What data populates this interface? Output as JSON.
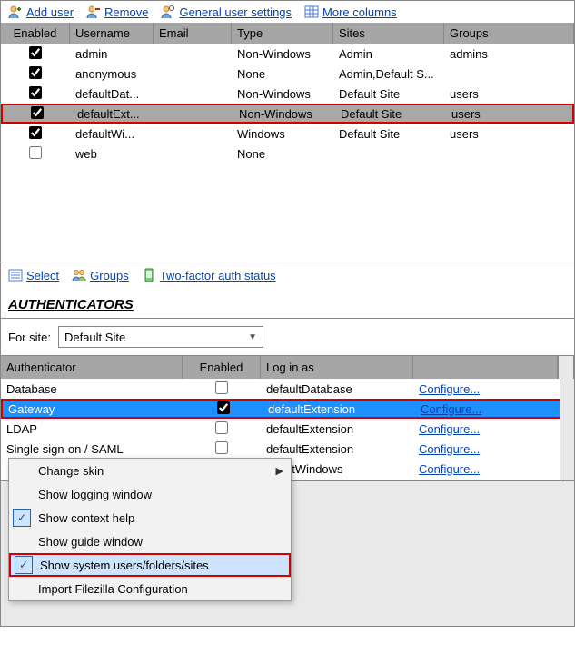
{
  "toolbar": {
    "add_user": "Add user",
    "remove": "Remove",
    "general": "General user settings",
    "more_cols": "More columns"
  },
  "user_grid": {
    "headers": {
      "enabled": "Enabled",
      "username": "Username",
      "email": "Email",
      "type": "Type",
      "sites": "Sites",
      "groups": "Groups"
    },
    "rows": [
      {
        "enabled": true,
        "username": "admin",
        "email": "",
        "type": "Non-Windows",
        "sites": "Admin",
        "groups": "admins",
        "selected": false
      },
      {
        "enabled": true,
        "username": "anonymous",
        "email": "",
        "type": "None",
        "sites": "Admin,Default S...",
        "groups": "",
        "selected": false
      },
      {
        "enabled": true,
        "username": "defaultDat...",
        "email": "",
        "type": "Non-Windows",
        "sites": "Default Site",
        "groups": "users",
        "selected": false
      },
      {
        "enabled": true,
        "username": "defaultExt...",
        "email": "",
        "type": "Non-Windows",
        "sites": "Default Site",
        "groups": "users",
        "selected": true
      },
      {
        "enabled": true,
        "username": "defaultWi...",
        "email": "",
        "type": "Windows",
        "sites": "Default Site",
        "groups": "users",
        "selected": false
      },
      {
        "enabled": false,
        "username": "web",
        "email": "",
        "type": "None",
        "sites": "",
        "groups": "",
        "selected": false
      }
    ]
  },
  "toolbar2": {
    "select": "Select",
    "groups": "Groups",
    "twofa": "Two-factor auth status"
  },
  "auth": {
    "heading": "AUTHENTICATORS",
    "for_site_label": "For site:",
    "for_site_value": "Default Site",
    "headers": {
      "authenticator": "Authenticator",
      "enabled": "Enabled",
      "login_as": "Log in as"
    },
    "configure_label": "Configure...",
    "rows": [
      {
        "name": "Database",
        "enabled": false,
        "login_as": "defaultDatabase",
        "selected": false
      },
      {
        "name": "Gateway",
        "enabled": true,
        "login_as": "defaultExtension",
        "selected": true
      },
      {
        "name": "LDAP",
        "enabled": false,
        "login_as": "defaultExtension",
        "selected": false
      },
      {
        "name": "Single sign-on / SAML",
        "enabled": false,
        "login_as": "defaultExtension",
        "selected": false
      },
      {
        "name": "",
        "enabled": null,
        "login_as": "efaultWindows",
        "selected": false
      }
    ]
  },
  "menu": {
    "items": [
      {
        "label": "Change skin",
        "checked": false,
        "submenu": true,
        "highlight": false
      },
      {
        "label": "Show logging window",
        "checked": false,
        "submenu": false,
        "highlight": false
      },
      {
        "label": "Show context help",
        "checked": true,
        "submenu": false,
        "highlight": false
      },
      {
        "label": "Show guide window",
        "checked": false,
        "submenu": false,
        "highlight": false
      },
      {
        "label": "Show system users/folders/sites",
        "checked": true,
        "submenu": false,
        "highlight": true
      },
      {
        "label": "Import Filezilla Configuration",
        "checked": false,
        "submenu": false,
        "highlight": false
      }
    ]
  }
}
